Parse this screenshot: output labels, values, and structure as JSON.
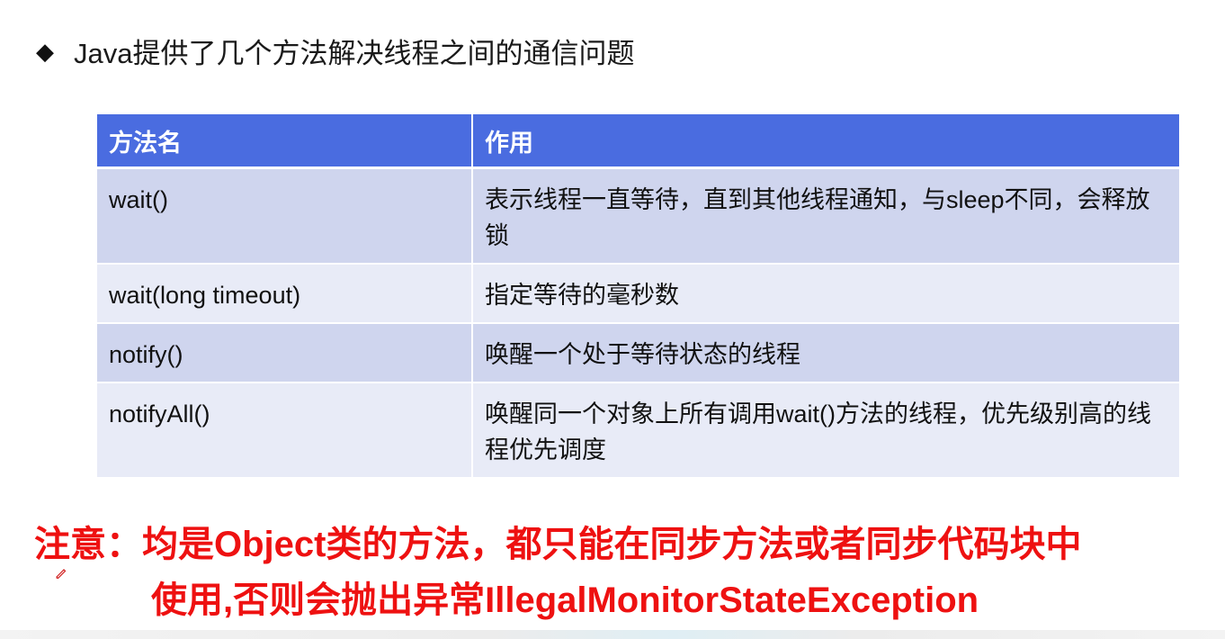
{
  "heading": {
    "bullet_icon": "diamond-bullet",
    "text": "Java提供了几个方法解决线程之间的通信问题"
  },
  "table": {
    "headers": [
      "方法名",
      "作用"
    ],
    "rows": [
      {
        "method": "wait()",
        "description": "表示线程一直等待，直到其他线程通知，与sleep不同，会释放锁"
      },
      {
        "method": "wait(long timeout)",
        "description": "指定等待的毫秒数"
      },
      {
        "method": "notify()",
        "description": "唤醒一个处于等待状态的线程"
      },
      {
        "method": "notifyAll()",
        "description": "唤醒同一个对象上所有调用wait()方法的线程，优先级别高的线程优先调度"
      }
    ],
    "colors": {
      "header_bg": "#4a6ce0",
      "row_dark": "#cfd5ee",
      "row_light": "#e8ebf7"
    }
  },
  "note": {
    "line1": "注意：均是Object类的方法，都只能在同步方法或者同步代码块中",
    "line2": "使用,否则会抛出异常IllegalMonitorStateException",
    "color": "#ee1111"
  },
  "cursor_icon": "pen-cursor-icon"
}
